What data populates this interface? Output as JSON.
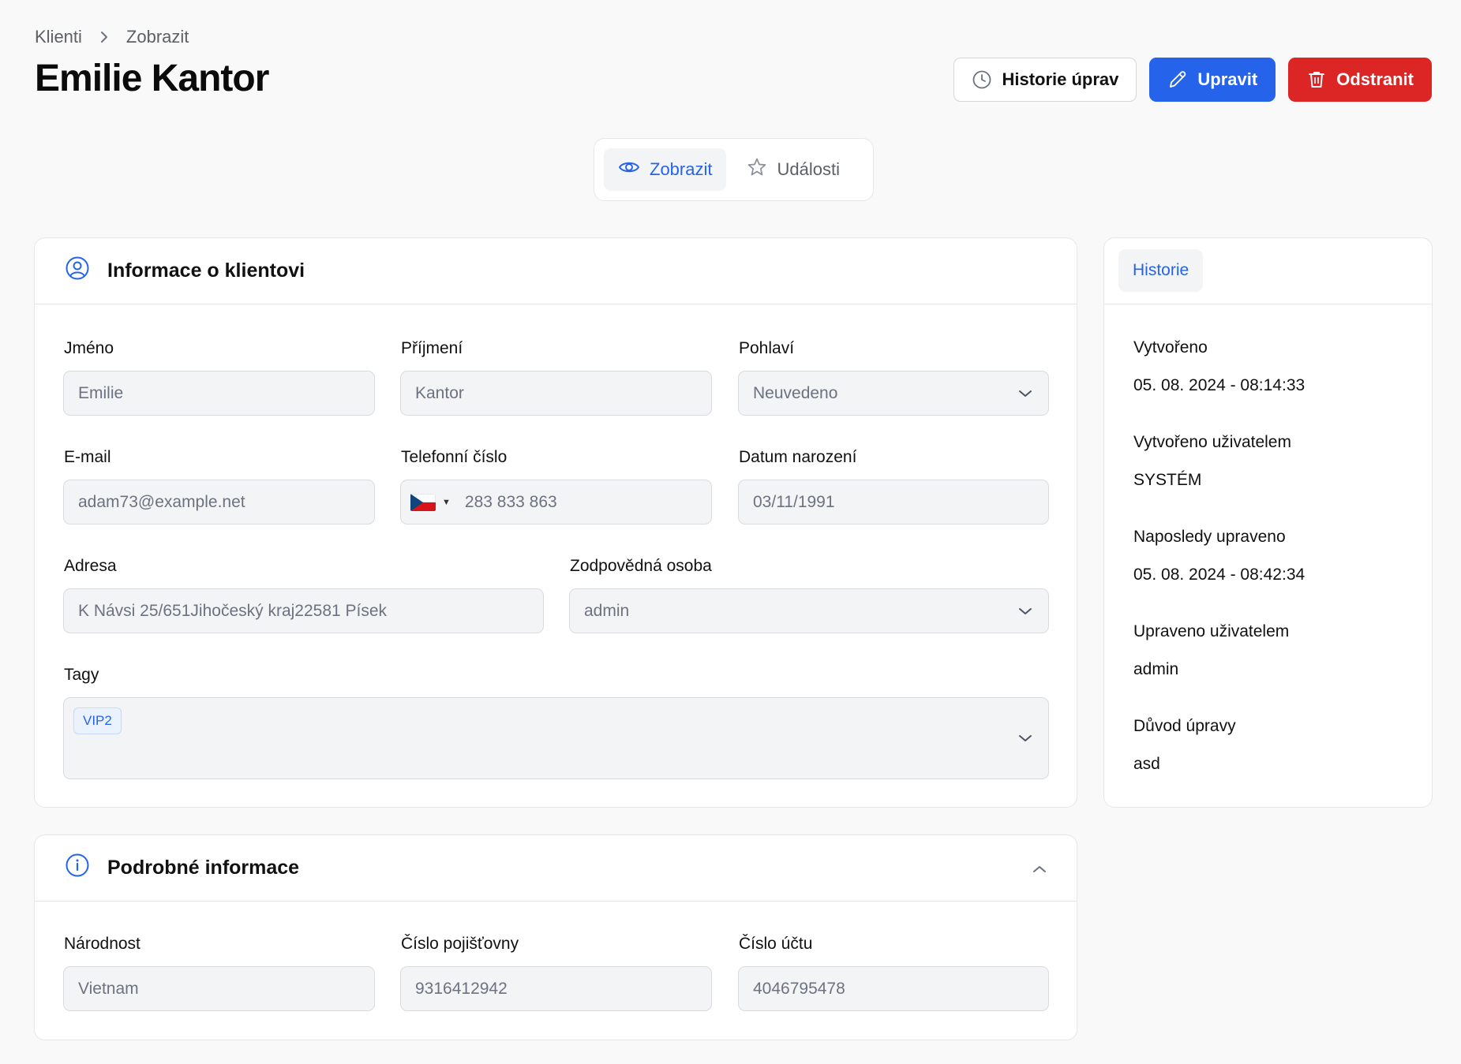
{
  "breadcrumb": {
    "parent": "Klienti",
    "current": "Zobrazit"
  },
  "page_title": "Emilie Kantor",
  "actions": {
    "history": "Historie úprav",
    "edit": "Upravit",
    "delete": "Odstranit"
  },
  "tabs": {
    "view": "Zobrazit",
    "events": "Události"
  },
  "client_info": {
    "title": "Informace o klientovi",
    "first_name": {
      "label": "Jméno",
      "value": "Emilie"
    },
    "last_name": {
      "label": "Příjmení",
      "value": "Kantor"
    },
    "gender": {
      "label": "Pohlaví",
      "value": "Neuvedeno"
    },
    "email": {
      "label": "E-mail",
      "value": "adam73@example.net"
    },
    "phone": {
      "label": "Telefonní číslo",
      "value": "283 833 863",
      "country": "CZ"
    },
    "birth_date": {
      "label": "Datum narození",
      "value": "03/11/1991"
    },
    "address": {
      "label": "Adresa",
      "value": "K Návsi 25/651Jihočeský kraj22581 Písek"
    },
    "responsible": {
      "label": "Zodpovědná osoba",
      "value": "admin"
    },
    "tags": {
      "label": "Tagy",
      "items": [
        "VIP2"
      ]
    }
  },
  "details": {
    "title": "Podrobné informace",
    "nationality": {
      "label": "Národnost",
      "value": "Vietnam"
    },
    "insurance": {
      "label": "Číslo pojišťovny",
      "value": "9316412942"
    },
    "account": {
      "label": "Číslo účtu",
      "value": "4046795478"
    }
  },
  "history": {
    "tab": "Historie",
    "created": {
      "label": "Vytvořeno",
      "value": "05. 08. 2024 - 08:14:33"
    },
    "created_by": {
      "label": "Vytvořeno uživatelem",
      "value": "SYSTÉM"
    },
    "updated": {
      "label": "Naposledy upraveno",
      "value": "05. 08. 2024 - 08:42:34"
    },
    "updated_by": {
      "label": "Upraveno uživatelem",
      "value": "admin"
    },
    "reason": {
      "label": "Důvod úpravy",
      "value": "asd"
    }
  },
  "colors": {
    "primary": "#2563eb",
    "danger": "#dc2626",
    "background": "#f9f9f9"
  },
  "icons": [
    "chevron-right-icon",
    "clock-icon",
    "pencil-icon",
    "trash-icon",
    "eye-icon",
    "star-icon",
    "user-circle-icon",
    "info-icon",
    "chevron-down-icon",
    "chevron-up-icon"
  ]
}
